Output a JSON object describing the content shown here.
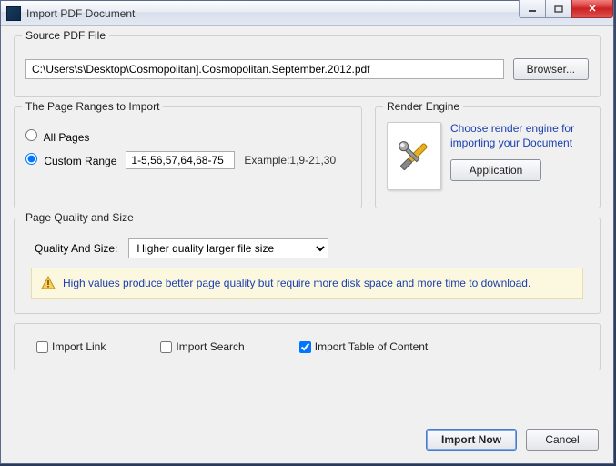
{
  "window": {
    "title": "Import PDF Document"
  },
  "source": {
    "legend": "Source PDF File",
    "path": "C:\\Users\\s\\Desktop\\Cosmopolitan].Cosmopolitan.September.2012.pdf",
    "browse_label": "Browser..."
  },
  "page_ranges": {
    "legend": "The Page Ranges to Import",
    "all_label": "All Pages",
    "custom_label": "Custom Range",
    "custom_value": "1-5,56,57,64,68-75",
    "example_label": "Example:1,9-21,30"
  },
  "render": {
    "legend": "Render Engine",
    "hint": "Choose render engine for importing your Document",
    "button_label": "Application"
  },
  "quality": {
    "legend": "Page Quality and Size",
    "label": "Quality And Size:",
    "selected": "Higher quality larger file size",
    "note": "High values produce better page quality but require more disk space and more time to download."
  },
  "import_opts": {
    "link_label": "Import Link",
    "search_label": "Import Search",
    "toc_label": "Import Table of Content"
  },
  "footer": {
    "import_label": "Import Now",
    "cancel_label": "Cancel"
  }
}
